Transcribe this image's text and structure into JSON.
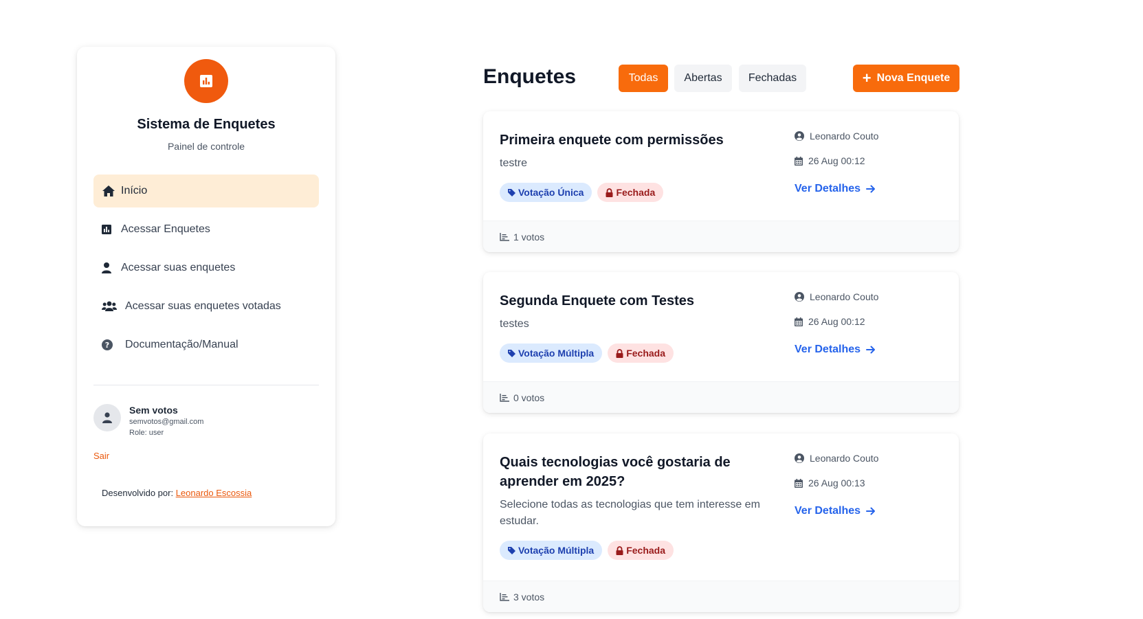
{
  "sidebar": {
    "logo_icon": "chart-icon",
    "title": "Sistema de Enquetes",
    "subtitle": "Painel de controle",
    "nav": [
      {
        "label": "Início",
        "icon": "home-icon",
        "active": true
      },
      {
        "label": "Acessar Enquetes",
        "icon": "chart-icon",
        "active": false
      },
      {
        "label": "Acessar suas enquetes",
        "icon": "user-icon",
        "active": false
      },
      {
        "label": "Acessar suas enquetes votadas",
        "icon": "users-icon",
        "active": false
      },
      {
        "label": "Documentação/Manual",
        "icon": "question-circle-icon",
        "active": false
      }
    ],
    "user": {
      "name": "Sem votos",
      "email": "semvotos@gmail.com",
      "role": "Role: user"
    },
    "logout_label": "Sair",
    "credit_prefix": "Desenvolvido por:",
    "credit_name": "Leonardo Escossia"
  },
  "header": {
    "title": "Enquetes",
    "filters": [
      "Todas",
      "Abertas",
      "Fechadas"
    ],
    "active_filter": "Todas",
    "new_button": "Nova Enquete"
  },
  "colors": {
    "accent": "#f86b0c",
    "link": "#2563eb",
    "active_nav_bg": "#feedd6"
  },
  "polls": [
    {
      "title": "Primeira enquete com permissões",
      "description": "testre",
      "type": "Votação Única",
      "status": "Fechada",
      "author": "Leonardo Couto",
      "date": "26 Aug 00:12",
      "details_label": "Ver Detalhes",
      "votes": "1 votos"
    },
    {
      "title": "Segunda Enquete com Testes",
      "description": "testes",
      "type": "Votação Múltipla",
      "status": "Fechada",
      "author": "Leonardo Couto",
      "date": "26 Aug 00:12",
      "details_label": "Ver Detalhes",
      "votes": "0 votos"
    },
    {
      "title": "Quais tecnologias você gostaria de aprender em 2025?",
      "description": "Selecione todas as tecnologias que tem interesse em estudar.",
      "type": "Votação Múltipla",
      "status": "Fechada",
      "author": "Leonardo Couto",
      "date": "26 Aug 00:13",
      "details_label": "Ver Detalhes",
      "votes": "3 votos"
    }
  ]
}
